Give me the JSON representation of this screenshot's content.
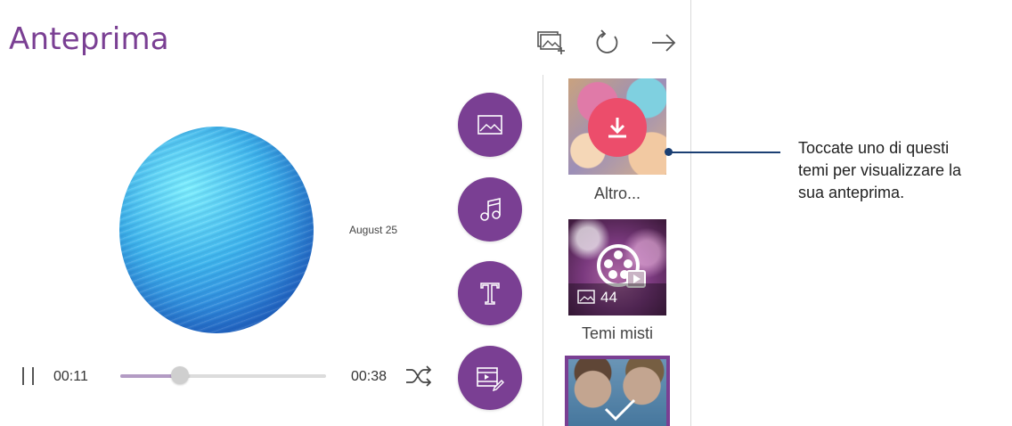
{
  "header": {
    "title": "Anteprima",
    "icons": [
      "add-photos-icon",
      "refresh-icon",
      "arrow-right-icon"
    ]
  },
  "preview": {
    "date_label": "August 25"
  },
  "player": {
    "current_time": "00:11",
    "total_time": "00:38",
    "progress": 0.29,
    "pause_icon": "pause-icon",
    "shuffle_icon": "shuffle-icon"
  },
  "tools": [
    "image-icon",
    "music-note-icon",
    "text-icon",
    "video-edit-icon"
  ],
  "themes": [
    {
      "label": "Altro...",
      "badge": "download-icon"
    },
    {
      "label": "Temi misti",
      "count": "44"
    },
    {
      "label": "",
      "selected": true
    }
  ],
  "callout": {
    "text": "Toccate uno di questi temi per visualizzare la sua anteprima."
  },
  "colors": {
    "accent": "#7a3f93",
    "download": "#ec4d6b",
    "callout_line": "#1b3f73"
  }
}
